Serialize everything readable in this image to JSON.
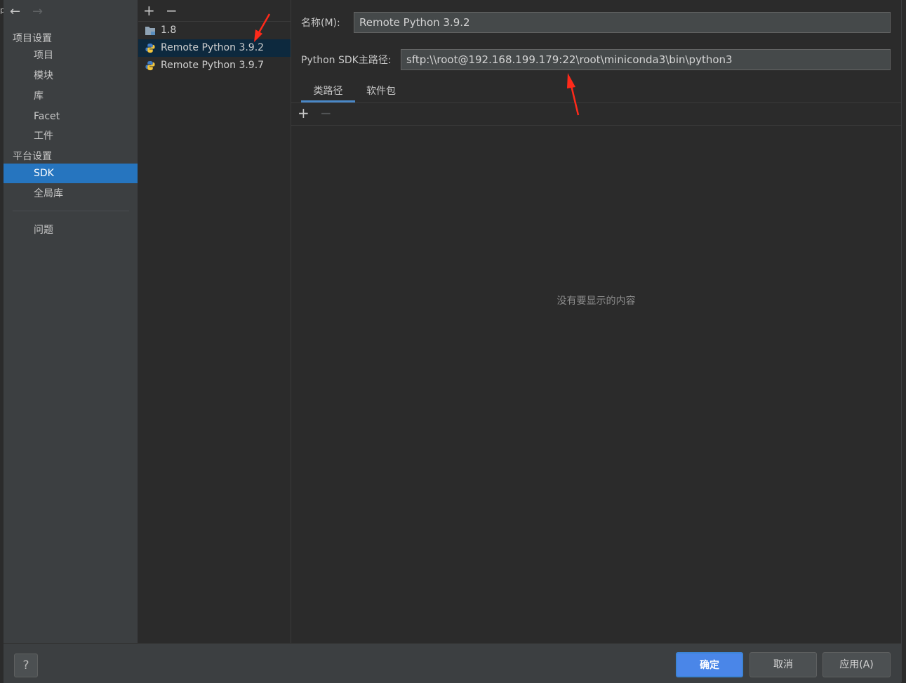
{
  "nav": {
    "sections": [
      {
        "label": "项目设置",
        "items": [
          "项目",
          "模块",
          "库",
          "Facet",
          "工件"
        ]
      },
      {
        "label": "平台设置",
        "items": [
          "SDK",
          "全局库"
        ]
      }
    ],
    "problems": "问题",
    "selected": "SDK"
  },
  "sdk_list": {
    "items": [
      {
        "label": "1.8",
        "icon": "folder-icon"
      },
      {
        "label": "Remote Python 3.9.2",
        "icon": "python-icon",
        "selected": true
      },
      {
        "label": "Remote Python 3.9.7",
        "icon": "python-icon"
      }
    ]
  },
  "detail": {
    "name_label": "名称(M):",
    "name_value": "Remote Python 3.9.2",
    "path_label": "Python SDK主路径:",
    "path_value": "sftp:\\\\root@192.168.199.179:22\\root\\miniconda3\\bin\\python3",
    "tabs": [
      "类路径",
      "软件包"
    ],
    "active_tab": "类路径",
    "empty_text": "没有要显示的内容"
  },
  "footer": {
    "help": "?",
    "ok": "确定",
    "cancel": "取消",
    "apply": "应用(A)"
  },
  "colors": {
    "accent": "#2675bf",
    "annotation_arrow": "#ff2a1a"
  }
}
